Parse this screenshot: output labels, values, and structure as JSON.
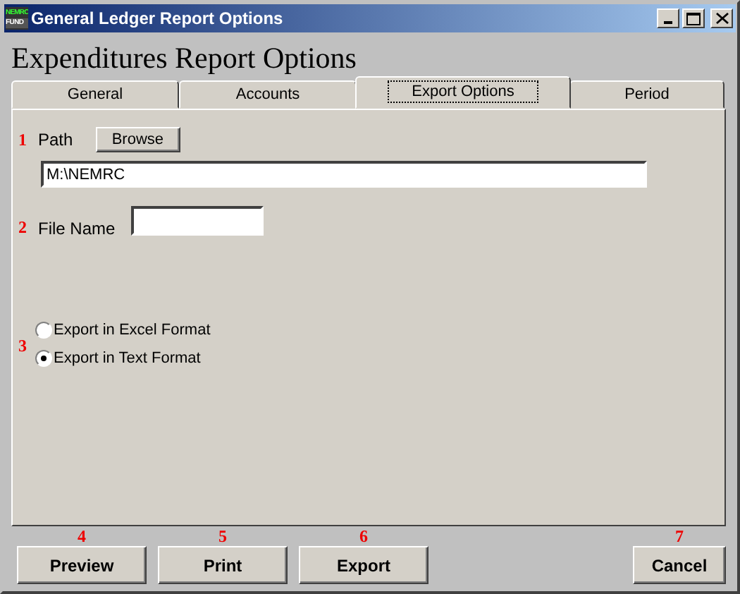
{
  "window": {
    "title": "General Ledger Report Options",
    "logo_lines": [
      "NEMRC",
      "FUND"
    ]
  },
  "heading": "Expenditures Report Options",
  "tabs": [
    {
      "label": "General",
      "selected": false
    },
    {
      "label": "Accounts",
      "selected": false
    },
    {
      "label": "Export Options",
      "selected": true
    },
    {
      "label": "Period",
      "selected": false
    }
  ],
  "path": {
    "callout": "1",
    "label": "Path",
    "browse_button": "Browse",
    "value": "M:\\NEMRC"
  },
  "file_name": {
    "callout": "2",
    "label": "File Name"
  },
  "format": {
    "callout": "3",
    "options": [
      {
        "label": "Export in Excel Format",
        "selected": false
      },
      {
        "label": "Export in Text Format",
        "selected": true
      }
    ]
  },
  "left_buttons": [
    {
      "label": "Preview",
      "callout": "4"
    },
    {
      "label": "Print",
      "callout": "5"
    },
    {
      "label": "Export",
      "callout": "6"
    }
  ],
  "right_buttons": [
    {
      "label": "Cancel",
      "callout": "7"
    }
  ]
}
